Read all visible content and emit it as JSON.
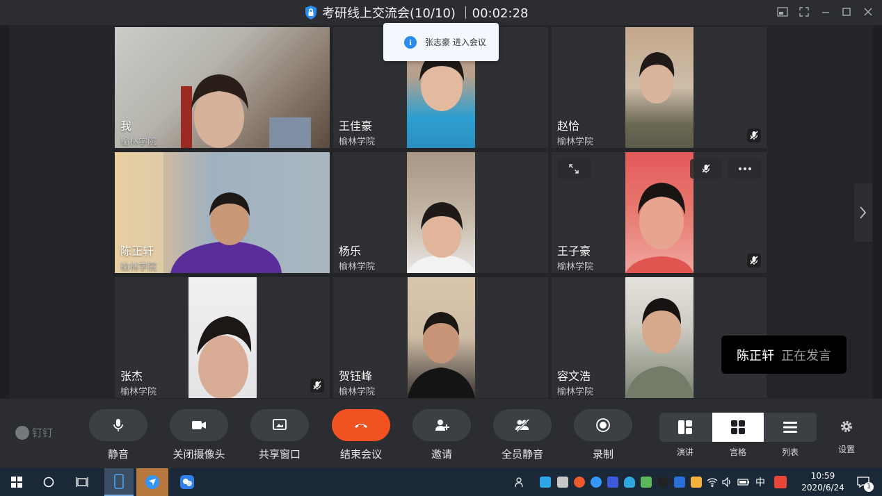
{
  "window": {
    "title": "考研线上交流会(10/10) ｜00:02:28"
  },
  "toast": {
    "text": "张志豪 进入会议"
  },
  "participants": [
    {
      "name": "我",
      "org": "榆林学院"
    },
    {
      "name": "王佳豪",
      "org": "榆林学院"
    },
    {
      "name": "赵恰",
      "org": "榆林学院"
    },
    {
      "name": "陈正轩",
      "org": "榆林学院"
    },
    {
      "name": "杨乐",
      "org": "榆林学院"
    },
    {
      "name": "王子豪",
      "org": "榆林学院"
    },
    {
      "name": "张杰",
      "org": "榆林学院"
    },
    {
      "name": "贺钰峰",
      "org": "榆林学院"
    },
    {
      "name": "容文浩",
      "org": "榆林学院"
    }
  ],
  "speaking": {
    "name": "陈正轩",
    "status": "正在发言"
  },
  "toolbar": {
    "brand": "钉钉",
    "buttons": [
      {
        "label": "静音"
      },
      {
        "label": "关闭摄像头"
      },
      {
        "label": "共享窗口"
      },
      {
        "label": "结束会议"
      },
      {
        "label": "邀请"
      },
      {
        "label": "全员静音"
      },
      {
        "label": "录制"
      }
    ],
    "layouts": [
      {
        "label": "演讲"
      },
      {
        "label": "宫格"
      },
      {
        "label": "列表"
      }
    ],
    "settings_label": "设置"
  },
  "taskbar": {
    "time": "10:59",
    "date": "2020/6/24",
    "ime": "中",
    "notification_count": "1"
  },
  "colors": {
    "active_speaker_border": "#2db24a",
    "end_call": "#f1521f",
    "toast_info": "#2b8cf0"
  }
}
